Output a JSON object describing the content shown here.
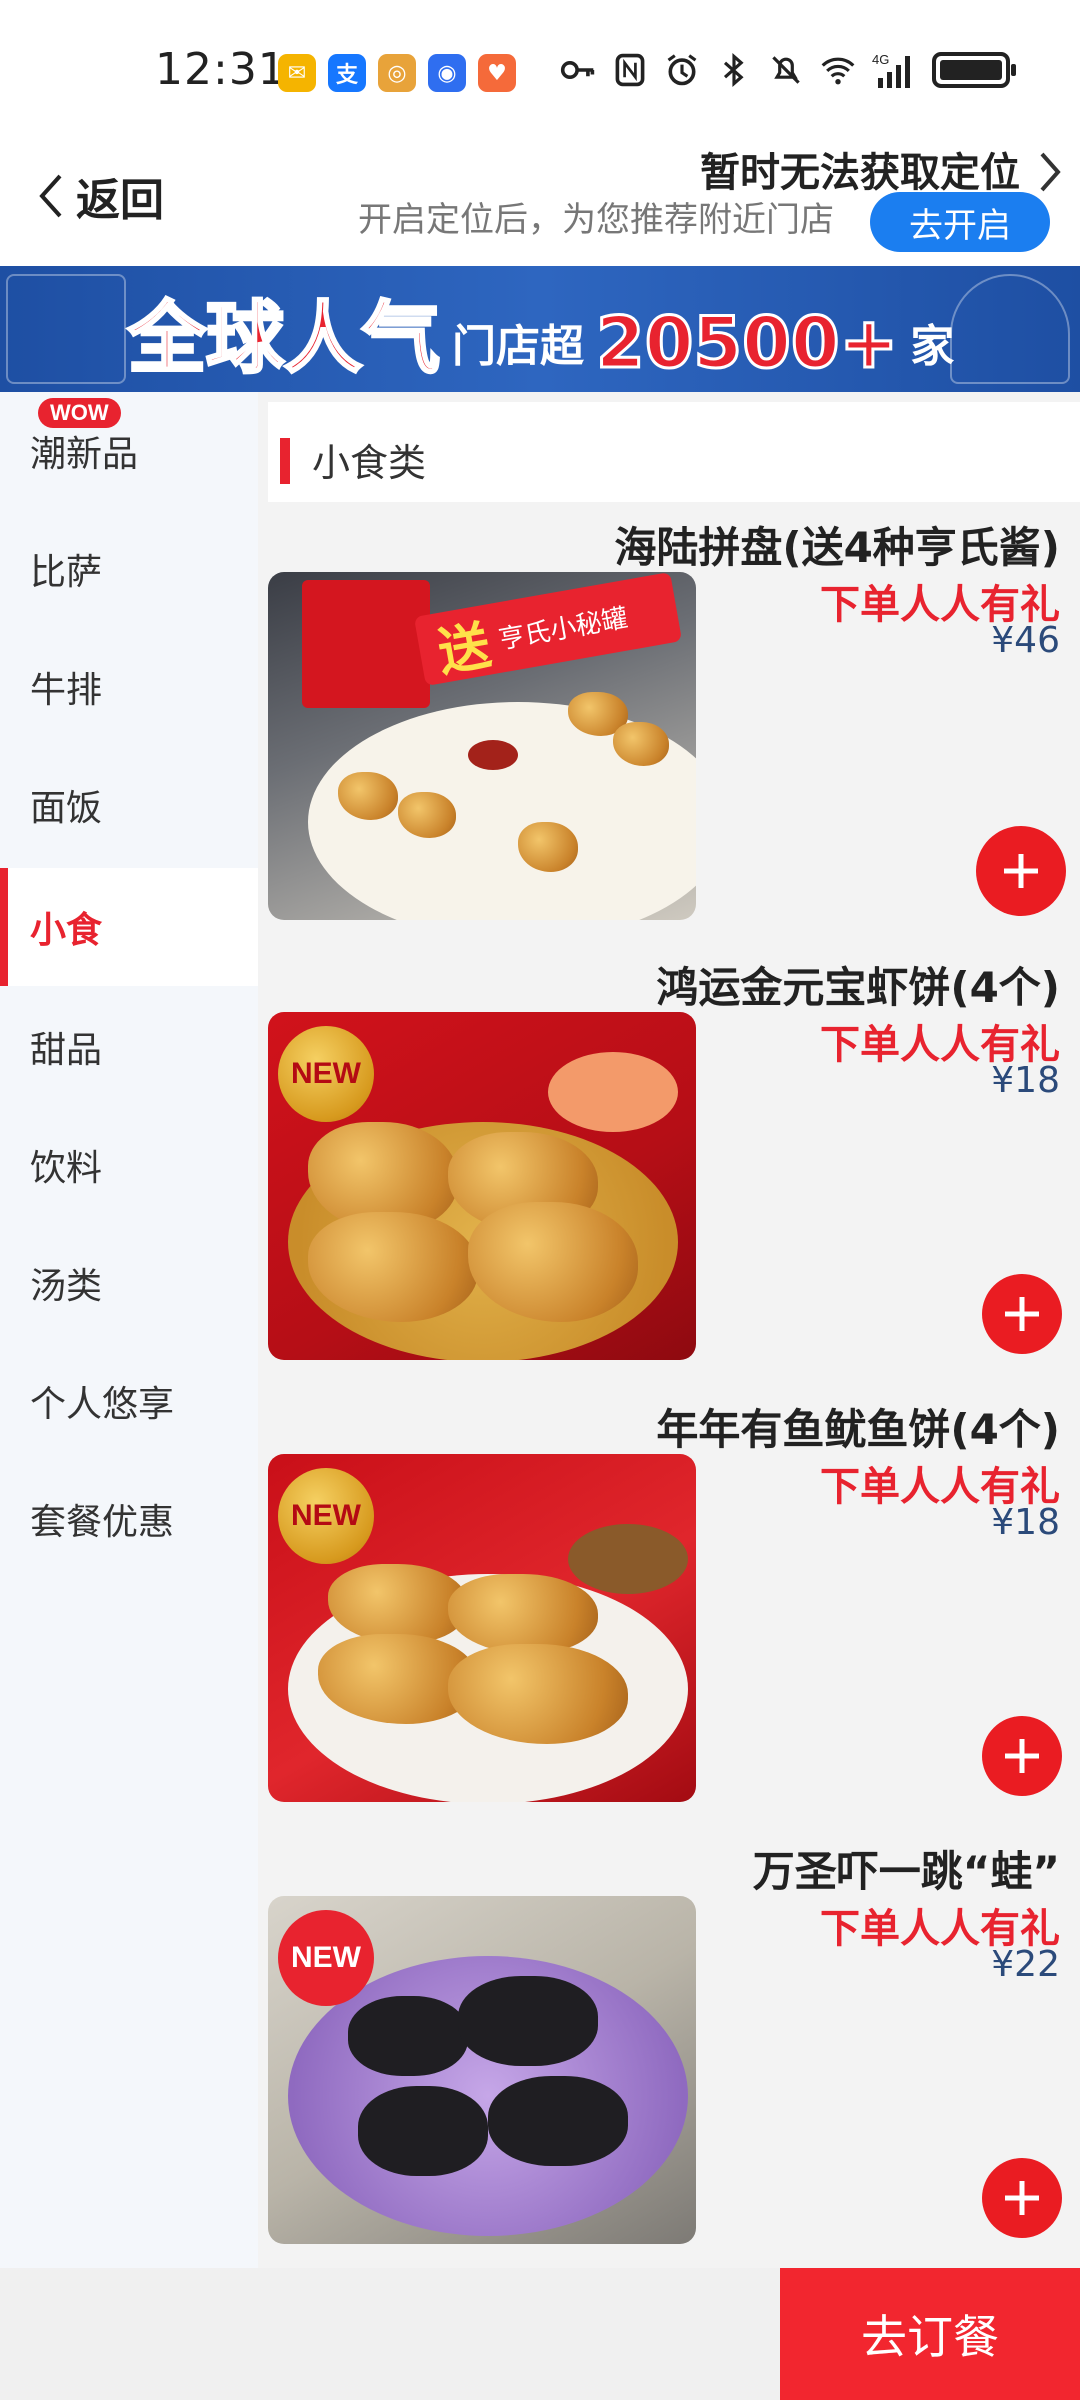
{
  "status_bar": {
    "time": "12:31",
    "app_icons": [
      "mail-icon",
      "alipay-icon",
      "app-icon",
      "app-icon",
      "app-icon"
    ],
    "battery": 1.0
  },
  "header": {
    "back_label": "返回",
    "location_title": "暂时无法获取定位",
    "location_subtitle": "开启定位后，为您推荐附近门店",
    "open_button": "去开启"
  },
  "banner": {
    "part1": "全球人气",
    "part2": "门店超",
    "part3": "20500+",
    "part4": "家"
  },
  "sidebar": {
    "badge": "WOW",
    "items": [
      {
        "label": "潮新品"
      },
      {
        "label": "比萨"
      },
      {
        "label": "牛排"
      },
      {
        "label": "面饭"
      },
      {
        "label": "小食"
      },
      {
        "label": "甜品"
      },
      {
        "label": "饮料"
      },
      {
        "label": "汤类"
      },
      {
        "label": "个人悠享"
      },
      {
        "label": "套餐优惠"
      }
    ],
    "active_index": 4
  },
  "category": {
    "title": "小食类"
  },
  "items": [
    {
      "name": "海陆拼盘(送4种亨氏酱)",
      "promo": "下单人人有礼",
      "price": "¥46",
      "image_text": "送",
      "image_text2": "亨氏小秘罐",
      "badge": ""
    },
    {
      "name": "鸿运金元宝虾饼(4个)",
      "promo": "下单人人有礼",
      "price": "¥18",
      "badge": "NEW"
    },
    {
      "name": "年年有鱼鱿鱼饼(4个)",
      "promo": "下单人人有礼",
      "price": "¥18",
      "badge": "NEW"
    },
    {
      "name": "万圣吓一跳“蛙”",
      "promo": "下单人人有礼",
      "price": "¥22",
      "badge": "NEW"
    }
  ],
  "bottom": {
    "order_button": "去订餐"
  },
  "colors": {
    "accent_red": "#e8232f",
    "blue": "#1b7ef0",
    "price_blue": "#2b4a7a"
  }
}
